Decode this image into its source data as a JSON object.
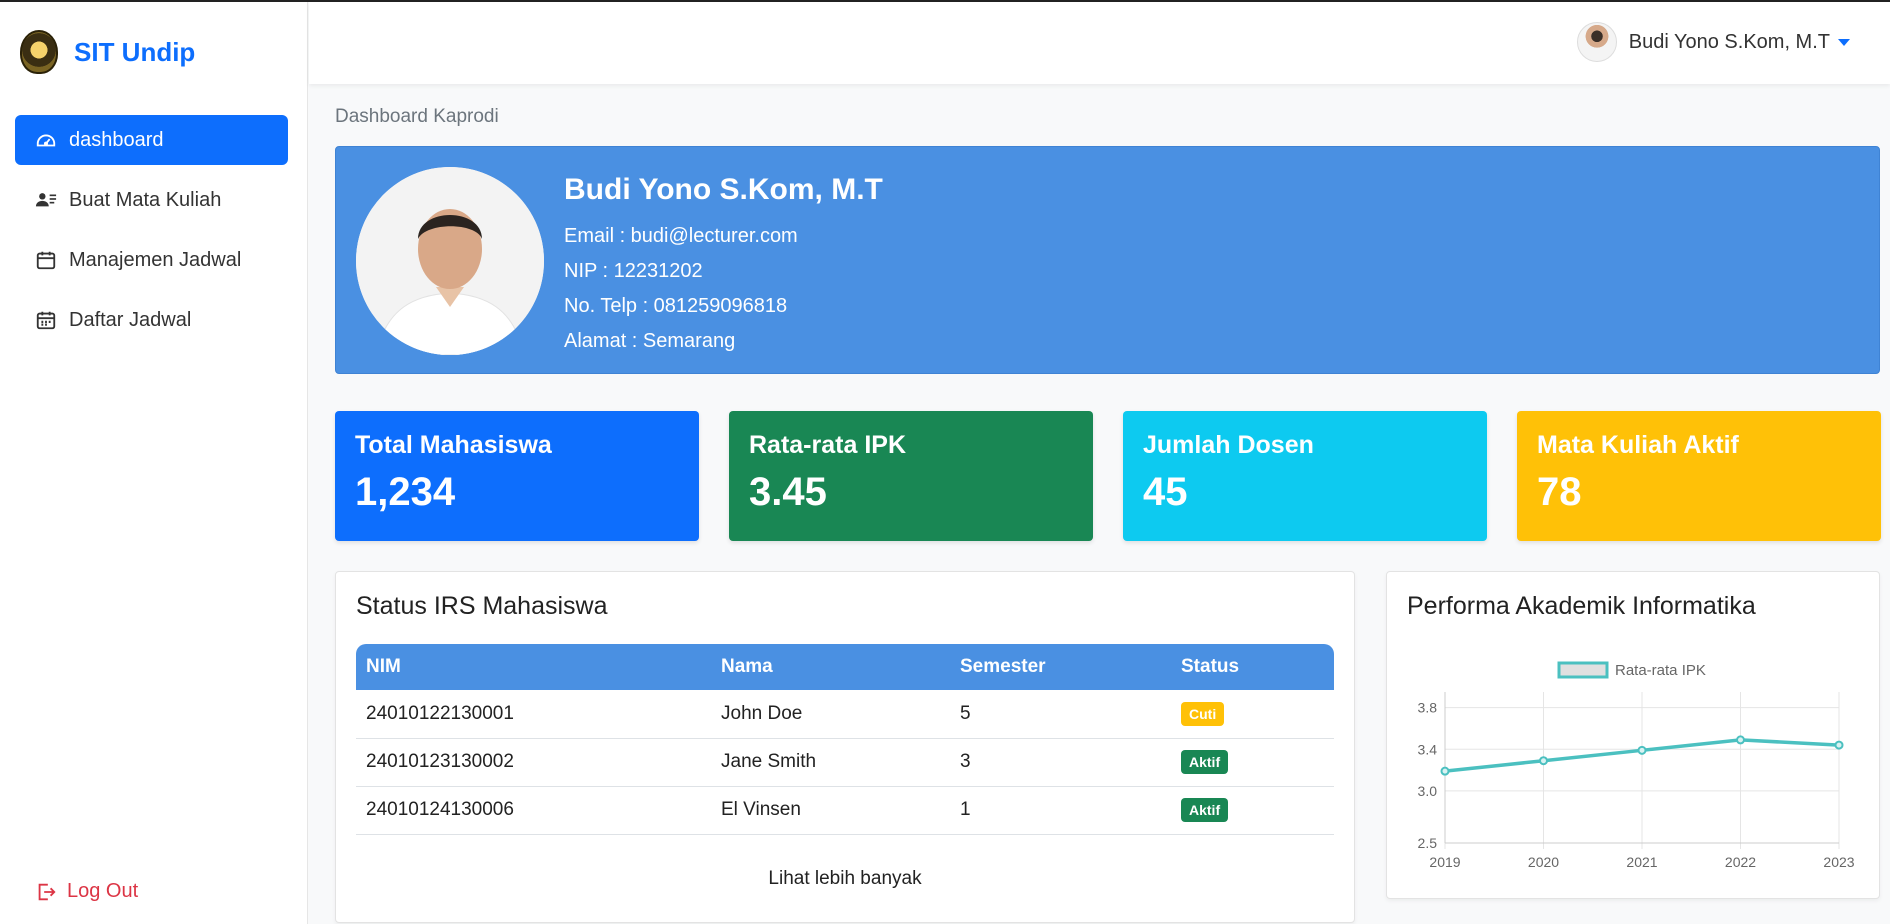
{
  "brand": {
    "name": "SIT Undip"
  },
  "sidebar": {
    "items": [
      {
        "label": "dashboard",
        "icon": "dashboard-icon",
        "active": true
      },
      {
        "label": "Buat Mata Kuliah",
        "icon": "user-list-icon",
        "active": false
      },
      {
        "label": "Manajemen Jadwal",
        "icon": "calendar-icon",
        "active": false
      },
      {
        "label": "Daftar Jadwal",
        "icon": "calendar-grid-icon",
        "active": false
      }
    ],
    "logout_label": "Log Out"
  },
  "topbar": {
    "user_name": "Budi Yono S.Kom, M.T"
  },
  "breadcrumb": "Dashboard Kaprodi",
  "profile": {
    "name": "Budi Yono S.Kom, M.T",
    "email": "Email : budi@lecturer.com",
    "nip": "NIP : 12231202",
    "phone": "No. Telp : 081259096818",
    "address": "Alamat : Semarang"
  },
  "stats": [
    {
      "label": "Total Mahasiswa",
      "value": "1,234",
      "color": "#0d6efd"
    },
    {
      "label": "Rata-rata IPK",
      "value": "3.45",
      "color": "#198754"
    },
    {
      "label": "Jumlah Dosen",
      "value": "45",
      "color": "#0dcaf0"
    },
    {
      "label": "Mata Kuliah Aktif",
      "value": "78",
      "color": "#ffc107"
    }
  ],
  "irs": {
    "title": "Status IRS Mahasiswa",
    "headers": [
      "NIM",
      "Nama",
      "Semester",
      "Status"
    ],
    "rows": [
      {
        "nim": "24010122130001",
        "nama": "John Doe",
        "semester": "5",
        "status": "Cuti",
        "status_color": "#ffc107"
      },
      {
        "nim": "24010123130002",
        "nama": "Jane Smith",
        "semester": "3",
        "status": "Aktif",
        "status_color": "#198754"
      },
      {
        "nim": "24010124130006",
        "nama": "El Vinsen",
        "semester": "1",
        "status": "Aktif",
        "status_color": "#198754"
      }
    ],
    "see_more": "Lihat lebih banyak"
  },
  "performance": {
    "title": "Performa Akademik Informatika"
  },
  "chart_data": {
    "type": "line",
    "title": "",
    "x": [
      "2019",
      "2020",
      "2021",
      "2022",
      "2023"
    ],
    "series": [
      {
        "name": "Rata-rata IPK",
        "values": [
          3.19,
          3.29,
          3.39,
          3.49,
          3.44
        ],
        "color": "#4bc0c0"
      }
    ],
    "yticks": [
      "2.5",
      "3.0",
      "3.4",
      "3.8"
    ],
    "ylim": [
      2.5,
      3.95
    ],
    "xlabel": "",
    "ylabel": "",
    "grid": true,
    "legend": "top"
  }
}
